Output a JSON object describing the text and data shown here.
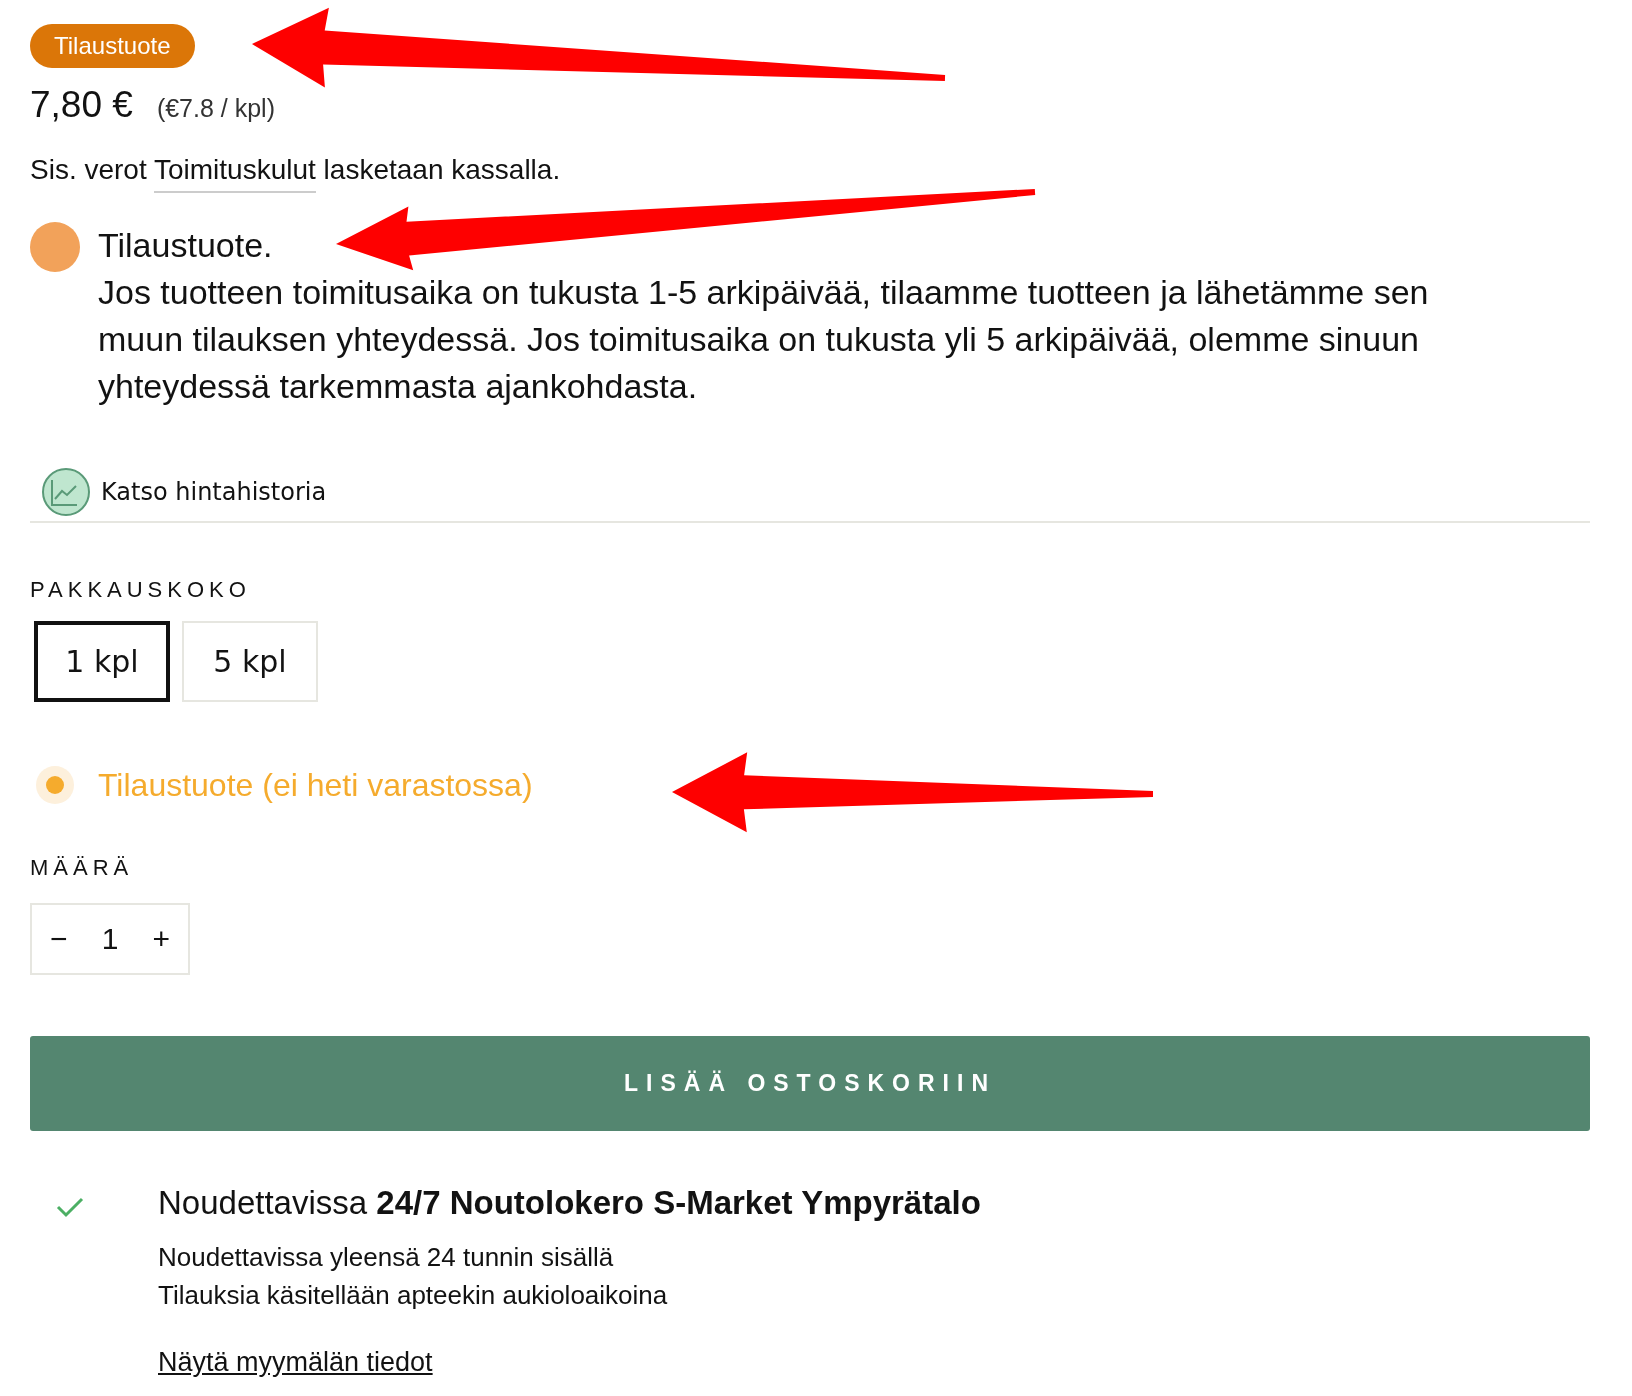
{
  "badge": "Tilaustuote",
  "price": {
    "amount": "7,80 €",
    "unit_price": "(€7.8 / kpl)"
  },
  "tax_note": {
    "before": "Sis. verot",
    "link": "Toimituskulut",
    "after": "lasketaan kassalla."
  },
  "notice": {
    "title": "Tilaustuote.",
    "text": "Jos tuotteen toimitusaika on tukusta 1-5 arkipäivää, tilaamme tuotteen ja lähetämme sen muun tilauksen yhteydessä. Jos toimitusaika on tukusta yli 5 arkipäivää, olemme sinuun yhteydessä tarkemmasta ajankohdasta."
  },
  "price_history_link": "Katso hintahistoria",
  "pack_size": {
    "label": "PAKKAUSKOKO",
    "options": [
      {
        "label": "1 kpl",
        "selected": true
      },
      {
        "label": "5 kpl",
        "selected": false
      }
    ]
  },
  "stock_status": "Tilaustuote (ei heti varastossa)",
  "quantity": {
    "label": "MÄÄRÄ",
    "decrement": "−",
    "value": "1",
    "increment": "+"
  },
  "add_to_cart": "LISÄÄ OSTOSKORIIN",
  "pickup": {
    "title": "Noudettavissa **24/7 Noutolokero S-Market Ympyrätalo**",
    "lines": [
      "Noudettavissa yleensä 24 tunnin sisällä",
      "Tilauksia käsitellään apteekin aukioloaikoina"
    ],
    "link": "Näytä myymälän tiedot"
  }
}
